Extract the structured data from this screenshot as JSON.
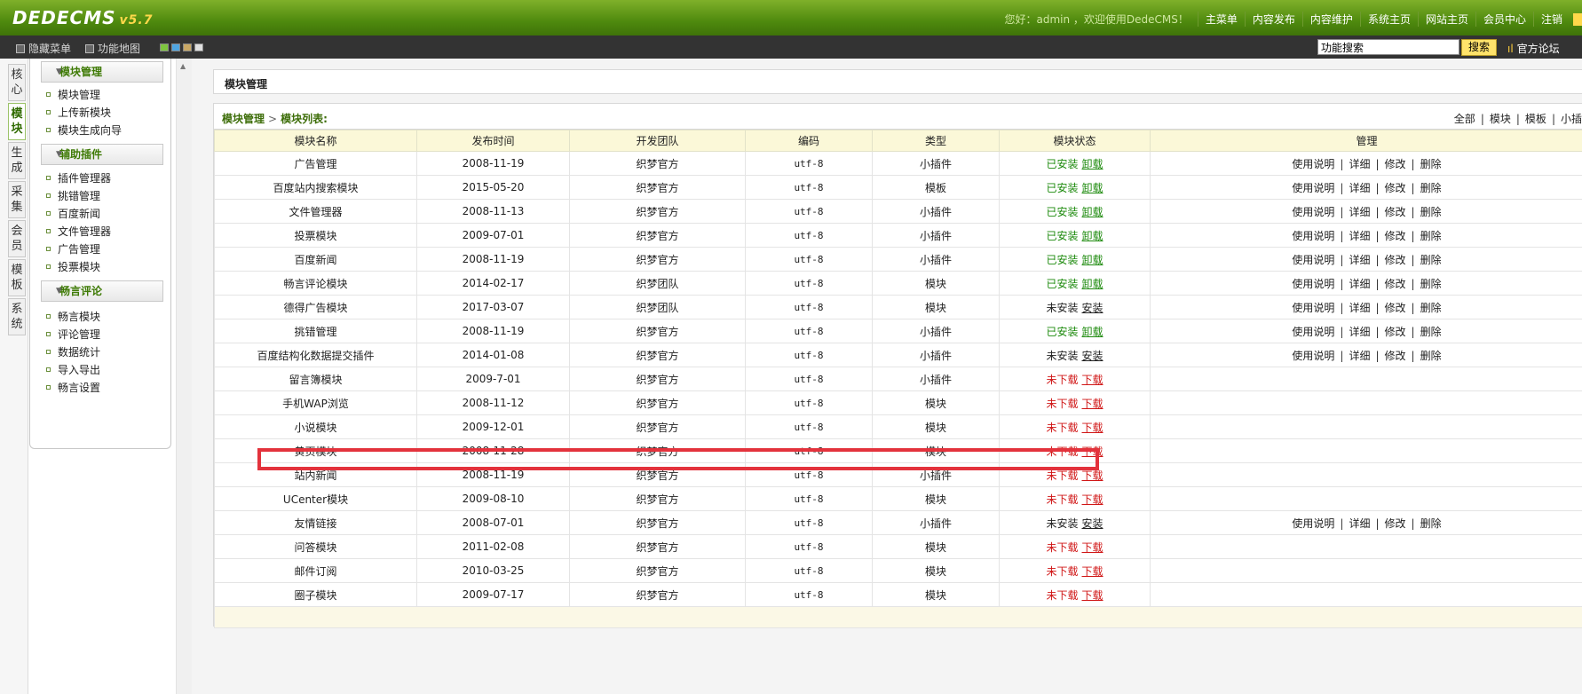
{
  "header": {
    "logo": "DEDECMS",
    "version": "v5.7",
    "greeting": "您好：admin ，欢迎使用DedeCMS！",
    "nav": [
      "主菜单",
      "内容发布",
      "内容维护",
      "系统主页",
      "网站主页",
      "会员中心",
      "注销"
    ]
  },
  "toolbar": {
    "hide_menu": "隐藏菜单",
    "feature_map": "功能地图",
    "search_value": "功能搜索",
    "search_button": "搜索",
    "forum": "官方论坛",
    "swatch_colors": [
      "#7ec63f",
      "#4fa6e2",
      "#c9a865",
      "#e0e0e0"
    ]
  },
  "vtabs": [
    "核心",
    "模块",
    "生成",
    "采集",
    "会员",
    "模板",
    "系统"
  ],
  "leftmenu": {
    "groups": [
      {
        "title": "模块管理",
        "items": [
          "模块管理",
          "上传新模块",
          "模块生成向导"
        ]
      },
      {
        "title": "辅助插件",
        "items": [
          "插件管理器",
          "挑错管理",
          "百度新闻",
          "文件管理器",
          "广告管理",
          "投票模块"
        ]
      },
      {
        "title": "畅言评论",
        "items": [
          "畅言模块",
          "评论管理",
          "数据统计",
          "导入导出",
          "畅言设置"
        ]
      }
    ]
  },
  "main": {
    "title": "模块管理",
    "breadcrumb": [
      "模块管理",
      "模块列表:"
    ],
    "filters": [
      "全部",
      "模块",
      "模板",
      "小插"
    ],
    "columns": [
      "模块名称",
      "发布时间",
      "开发团队",
      "编码",
      "类型",
      "模块状态",
      "管理"
    ],
    "manage_links": [
      "使用说明",
      "详细",
      "修改",
      "删除"
    ],
    "rows": [
      {
        "name": "广告管理",
        "date": "2008-11-19",
        "team": "织梦官方",
        "enc": "utf-8",
        "type": "小插件",
        "status": "已安装",
        "action": "卸载",
        "kind": "installed"
      },
      {
        "name": "百度站内搜索模块",
        "date": "2015-05-20",
        "team": "织梦官方",
        "enc": "utf-8",
        "type": "模板",
        "status": "已安装",
        "action": "卸载",
        "kind": "installed"
      },
      {
        "name": "文件管理器",
        "date": "2008-11-13",
        "team": "织梦官方",
        "enc": "utf-8",
        "type": "小插件",
        "status": "已安装",
        "action": "卸载",
        "kind": "installed"
      },
      {
        "name": "投票模块",
        "date": "2009-07-01",
        "team": "织梦官方",
        "enc": "utf-8",
        "type": "小插件",
        "status": "已安装",
        "action": "卸载",
        "kind": "installed"
      },
      {
        "name": "百度新闻",
        "date": "2008-11-19",
        "team": "织梦官方",
        "enc": "utf-8",
        "type": "小插件",
        "status": "已安装",
        "action": "卸载",
        "kind": "installed"
      },
      {
        "name": "畅言评论模块",
        "date": "2014-02-17",
        "team": "织梦团队",
        "enc": "utf-8",
        "type": "模块",
        "status": "已安装",
        "action": "卸载",
        "kind": "installed"
      },
      {
        "name": "德得广告模块",
        "date": "2017-03-07",
        "team": "织梦团队",
        "enc": "utf-8",
        "type": "模块",
        "status": "未安装",
        "action": "安装",
        "kind": "notinstalled"
      },
      {
        "name": "挑错管理",
        "date": "2008-11-19",
        "team": "织梦官方",
        "enc": "utf-8",
        "type": "小插件",
        "status": "已安装",
        "action": "卸载",
        "kind": "installed"
      },
      {
        "name": "百度结构化数据提交插件",
        "date": "2014-01-08",
        "team": "织梦官方",
        "enc": "utf-8",
        "type": "小插件",
        "status": "未安装",
        "action": "安装",
        "kind": "notinstalled"
      },
      {
        "name": "留言簿模块",
        "date": "2009-7-01",
        "team": "织梦官方",
        "enc": "utf-8",
        "type": "小插件",
        "status": "未下载",
        "action": "下载",
        "kind": "notdownloaded"
      },
      {
        "name": "手机WAP浏览",
        "date": "2008-11-12",
        "team": "织梦官方",
        "enc": "utf-8",
        "type": "模块",
        "status": "未下载",
        "action": "下载",
        "kind": "notdownloaded"
      },
      {
        "name": "小说模块",
        "date": "2009-12-01",
        "team": "织梦官方",
        "enc": "utf-8",
        "type": "模块",
        "status": "未下载",
        "action": "下载",
        "kind": "notdownloaded"
      },
      {
        "name": "黄页模块",
        "date": "2008-11-28",
        "team": "织梦官方",
        "enc": "utf-8",
        "type": "模块",
        "status": "未下载",
        "action": "下载",
        "kind": "notdownloaded"
      },
      {
        "name": "站内新闻",
        "date": "2008-11-19",
        "team": "织梦官方",
        "enc": "utf-8",
        "type": "小插件",
        "status": "未下载",
        "action": "下载",
        "kind": "notdownloaded"
      },
      {
        "name": "UCenter模块",
        "date": "2009-08-10",
        "team": "织梦官方",
        "enc": "utf-8",
        "type": "模块",
        "status": "未下载",
        "action": "下载",
        "kind": "notdownloaded"
      },
      {
        "name": "友情链接",
        "date": "2008-07-01",
        "team": "织梦官方",
        "enc": "utf-8",
        "type": "小插件",
        "status": "未安装",
        "action": "安装",
        "kind": "notinstalled"
      },
      {
        "name": "问答模块",
        "date": "2011-02-08",
        "team": "织梦官方",
        "enc": "utf-8",
        "type": "模块",
        "status": "未下载",
        "action": "下载",
        "kind": "notdownloaded"
      },
      {
        "name": "邮件订阅",
        "date": "2010-03-25",
        "team": "织梦官方",
        "enc": "utf-8",
        "type": "模块",
        "status": "未下载",
        "action": "下载",
        "kind": "notdownloaded"
      },
      {
        "name": "圈子模块",
        "date": "2009-07-17",
        "team": "织梦官方",
        "enc": "utf-8",
        "type": "模块",
        "status": "未下载",
        "action": "下载",
        "kind": "notdownloaded"
      }
    ]
  },
  "colors": {
    "installed": "#1c8a0c",
    "notdownloaded": "#d01616",
    "highlight": "#e3323c",
    "header_green": "#4f8a0e"
  }
}
